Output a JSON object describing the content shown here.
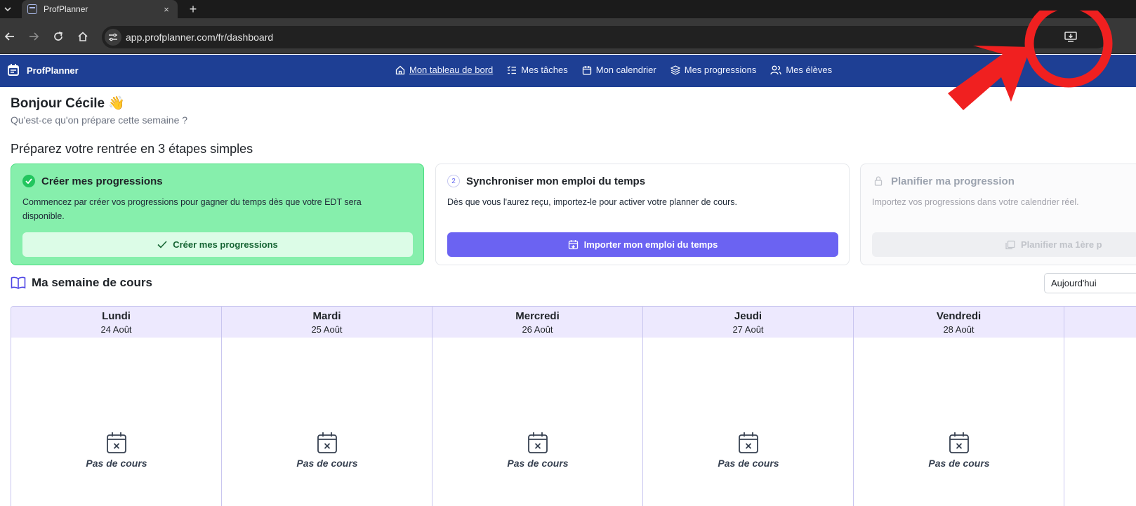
{
  "browser": {
    "tab_title": "ProfPlanner",
    "tab_close": "×",
    "new_tab": "+",
    "url": "app.profplanner.com/fr/dashboard"
  },
  "app": {
    "brand": "ProfPlanner",
    "nav": [
      {
        "label": "Mon tableau de bord",
        "icon": "home-icon",
        "active": true
      },
      {
        "label": "Mes tâches",
        "icon": "tasks-icon"
      },
      {
        "label": "Mon calendrier",
        "icon": "calendar-icon"
      },
      {
        "label": "Mes progressions",
        "icon": "layers-icon"
      },
      {
        "label": "Mes élèves",
        "icon": "users-icon"
      }
    ]
  },
  "greeting": {
    "title": "Bonjour Cécile 👋",
    "subtitle": "Qu'est-ce qu'on prépare cette semaine ?"
  },
  "steps": {
    "title": "Préparez votre rentrée en 3 étapes simples",
    "items": [
      {
        "title": "Créer mes progressions",
        "text": "Commencez par créer vos progressions pour gagner du temps dès que votre EDT sera disponible.",
        "button": "Créer mes progressions",
        "status": "done"
      },
      {
        "badge": "2",
        "title": "Synchroniser mon emploi du temps",
        "text": "Dès que vous l'aurez reçu, importez-le pour activer votre planner de cours.",
        "button": "Importer mon emploi du temps",
        "status": "active"
      },
      {
        "title": "Planifier ma progression",
        "text": "Importez vos progressions dans votre calendrier réel.",
        "button": "Planifier ma 1ère p",
        "status": "locked"
      }
    ]
  },
  "week": {
    "title": "Ma semaine de cours",
    "today_button": "Aujourd'hui",
    "empty_text": "Pas de cours",
    "days": [
      {
        "name": "Lundi",
        "date": "24 Août"
      },
      {
        "name": "Mardi",
        "date": "25 Août"
      },
      {
        "name": "Mercredi",
        "date": "26 Août"
      },
      {
        "name": "Jeudi",
        "date": "27 Août"
      },
      {
        "name": "Vendredi",
        "date": "28 Août"
      }
    ]
  },
  "colors": {
    "appbar": "#1e3f94",
    "primary": "#6b63f2",
    "done_card": "#86efac",
    "annotation": "#f02020"
  }
}
